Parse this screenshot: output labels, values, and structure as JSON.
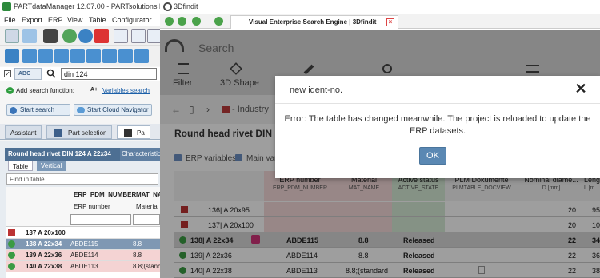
{
  "left_app": {
    "title": "PARTdataManager 12.07.00 - PARTsolutions by CADE",
    "menu": [
      "File",
      "Export",
      "ERP",
      "View",
      "Table",
      "Configurator"
    ],
    "search": {
      "mode_label": "ABC",
      "value": "din 124",
      "add_function_label": "Add search function:",
      "variables_label": "Variables search",
      "start_search": "Start search",
      "start_cloud": "Start Cloud Navigator"
    },
    "tabs": [
      "Assistant",
      "Part selection",
      "Pa"
    ],
    "grid": {
      "title": "Round head rivet DIN 124 A 22x34",
      "characteristics_tab": "Characteristic",
      "subtabs": [
        "Table",
        "Vertical"
      ],
      "find_placeholder": "Find in table...",
      "col_headers": [
        "ERP_PDM_NUMBER",
        "MAT_NA"
      ],
      "col_subheaders": [
        "ERP number",
        "Material"
      ],
      "rows": [
        {
          "name": "137 A 20x100",
          "erp": "",
          "mat": ""
        },
        {
          "name": "138 A 22x34",
          "erp": "ABDE115",
          "mat": "8.8"
        },
        {
          "name": "139 A 22x36",
          "erp": "ABDE114",
          "mat": "8.8"
        },
        {
          "name": "140 A 22x38",
          "erp": "ABDE113",
          "mat": "8.8;(stanc"
        }
      ]
    }
  },
  "right_app": {
    "title": "3Dfindit",
    "tab_title": "Visual Enterprise Search Engine | 3Dfindit",
    "search_placeholder": "Search",
    "toolbar": [
      "Filter",
      "3D Shape"
    ],
    "breadcrumb": "- Industry",
    "page_title": "Round head rivet DIN 12",
    "options": [
      "ERP variables",
      "Main var"
    ],
    "table": {
      "headers": [
        {
          "label": "ERP number",
          "sub": "ERP_PDM_NUMBER"
        },
        {
          "label": "Material",
          "sub": "MAT_NAME"
        },
        {
          "label": "Active status",
          "sub": "ACTIVE_STATE"
        },
        {
          "label": "PLM Dokumente",
          "sub": "PLMTABLE_DOCVIEW"
        },
        {
          "label": "Nominal diame...",
          "sub": "D [mm]"
        },
        {
          "label": "Leng",
          "sub": "L [m"
        }
      ],
      "rows": [
        {
          "name": "136| A 20x95",
          "erp": "",
          "mat": "",
          "status": "",
          "d": "20",
          "l": "95"
        },
        {
          "name": "137| A 20x100",
          "erp": "",
          "mat": "",
          "status": "",
          "d": "20",
          "l": "100"
        },
        {
          "name": "138| A 22x34",
          "erp": "ABDE115",
          "mat": "8.8",
          "status": "Released",
          "d": "22",
          "l": "34"
        },
        {
          "name": "139| A 22x36",
          "erp": "ABDE114",
          "mat": "8.8",
          "status": "Released",
          "d": "22",
          "l": "36"
        },
        {
          "name": "140| A 22x38",
          "erp": "ABDE113",
          "mat": "8.8;(standard",
          "status": "Released",
          "d": "22",
          "l": "38"
        }
      ]
    }
  },
  "dialog": {
    "title": "new ident-no.",
    "message": "Error: The table has changed meanwhile. The project is reloaded to update the ERP datasets.",
    "ok_label": "OK"
  }
}
